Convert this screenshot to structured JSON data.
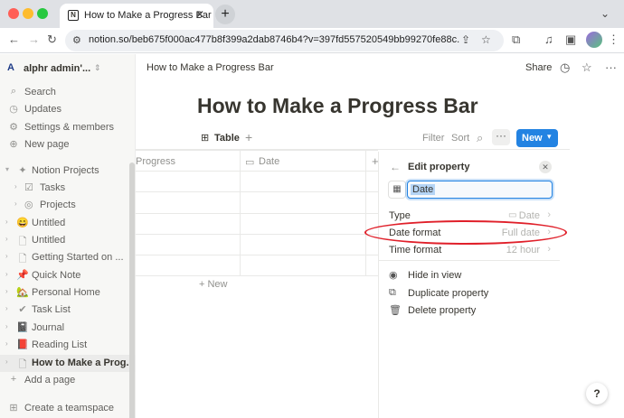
{
  "browser": {
    "tab_title": "How to Make a Progress Bar",
    "tab_favicon": "N",
    "tab_close": "✕",
    "new_tab": "+",
    "url": "notion.so/beb675f000ac477b8f399a2dab8746b4?v=397fd557520549bb99270fe88c..."
  },
  "sidebar": {
    "workspace": "alphr admin'...",
    "workspace_logo": "A",
    "nav": [
      {
        "icon": "⌕",
        "label": "Search"
      },
      {
        "icon": "◷",
        "label": "Updates"
      },
      {
        "icon": "⚙",
        "label": "Settings & members"
      },
      {
        "icon": "⊕",
        "label": "New page"
      }
    ],
    "pages": [
      {
        "icon": "✦",
        "label": "Notion Projects"
      },
      {
        "icon": "☑",
        "label": "Tasks"
      },
      {
        "icon": "◎",
        "label": "Projects"
      },
      {
        "icon": "😄",
        "label": "Untitled"
      },
      {
        "icon": "🗋",
        "label": "Untitled"
      },
      {
        "icon": "🗋",
        "label": "Getting Started on ..."
      },
      {
        "icon": "📌",
        "label": "Quick Note"
      },
      {
        "icon": "🏡",
        "label": "Personal Home"
      },
      {
        "icon": "✔",
        "label": "Task List"
      },
      {
        "icon": "📓",
        "label": "Journal"
      },
      {
        "icon": "📕",
        "label": "Reading List"
      },
      {
        "icon": "🗋",
        "label": "How to Make a Prog..."
      }
    ],
    "add_page": "Add a page",
    "create_teamspace": "Create a teamspace"
  },
  "topbar": {
    "breadcrumb": "How to Make a Progress Bar",
    "share": "Share"
  },
  "page": {
    "title": "How to Make a Progress Bar"
  },
  "viewbar": {
    "tab_label": "Table",
    "add_view": "+",
    "filter": "Filter",
    "sort": "Sort",
    "more": "···",
    "new_label": "New"
  },
  "table": {
    "columns": [
      "Progress",
      "Date",
      "+"
    ],
    "add_row": "+ New"
  },
  "panel": {
    "title": "Edit property",
    "name_value": "Date",
    "rows": [
      {
        "key": "Type",
        "value": "Date"
      },
      {
        "key": "Date format",
        "value": "Full date"
      },
      {
        "key": "Time format",
        "value": "12 hour"
      }
    ],
    "actions": [
      {
        "icon": "◉",
        "label": "Hide in view"
      },
      {
        "icon": "⧉",
        "label": "Duplicate property"
      },
      {
        "icon": "🗑",
        "label": "Delete property"
      }
    ]
  },
  "help": "?",
  "colors": {
    "accent": "#2383e2",
    "annotation": "#e0202a"
  }
}
